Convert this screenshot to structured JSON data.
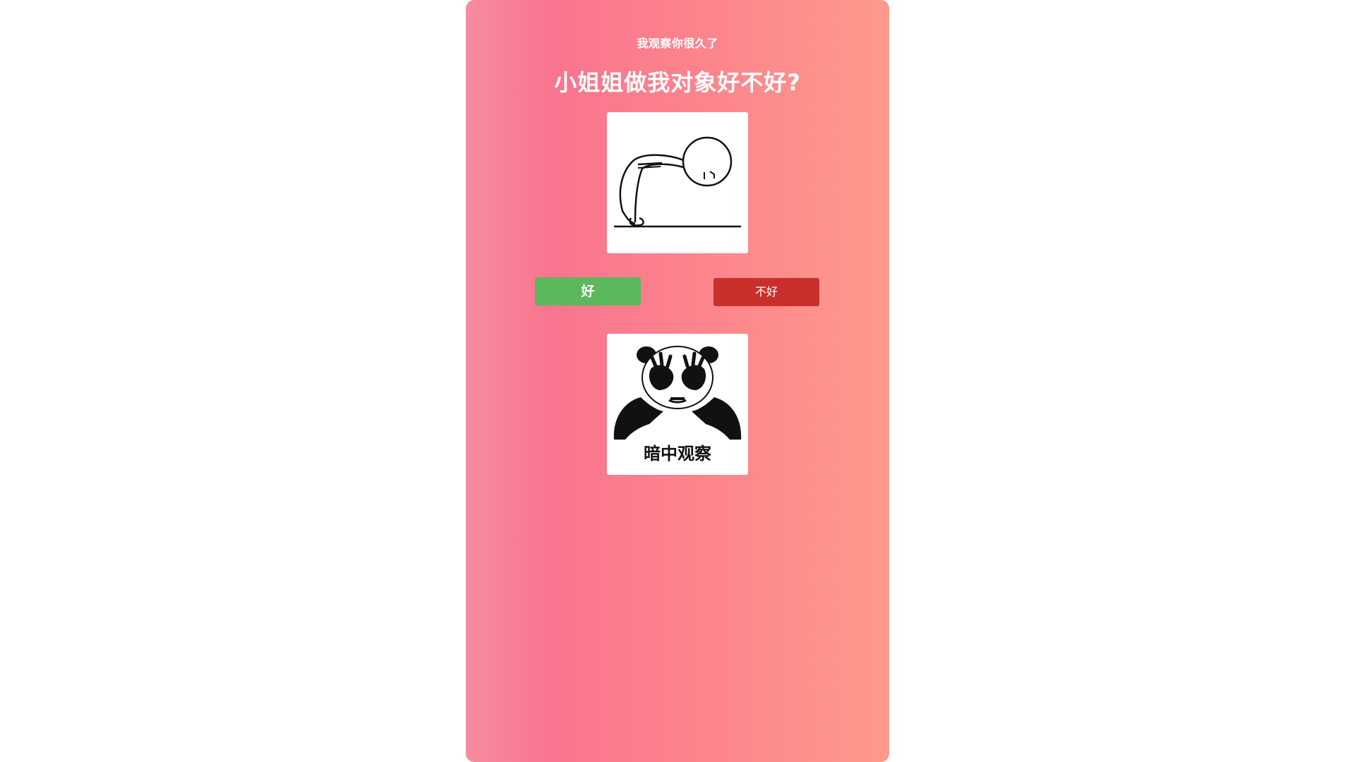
{
  "page": {
    "subtitle": "我观察你很久了",
    "title": "小姐姐做我对象好不好?"
  },
  "buttons": {
    "yes_label": "好",
    "no_label": "不好"
  },
  "memes": {
    "top": {
      "icon": "bowing-stickman-meme"
    },
    "bottom": {
      "icon": "panda-peeking-meme",
      "caption": "暗中观察"
    }
  },
  "colors": {
    "yes_button": "#5cb85c",
    "no_button": "#c9302c",
    "gradient_start": "#f78ca0",
    "gradient_mid": "#f9748f",
    "gradient_end": "#fe9a8b"
  }
}
